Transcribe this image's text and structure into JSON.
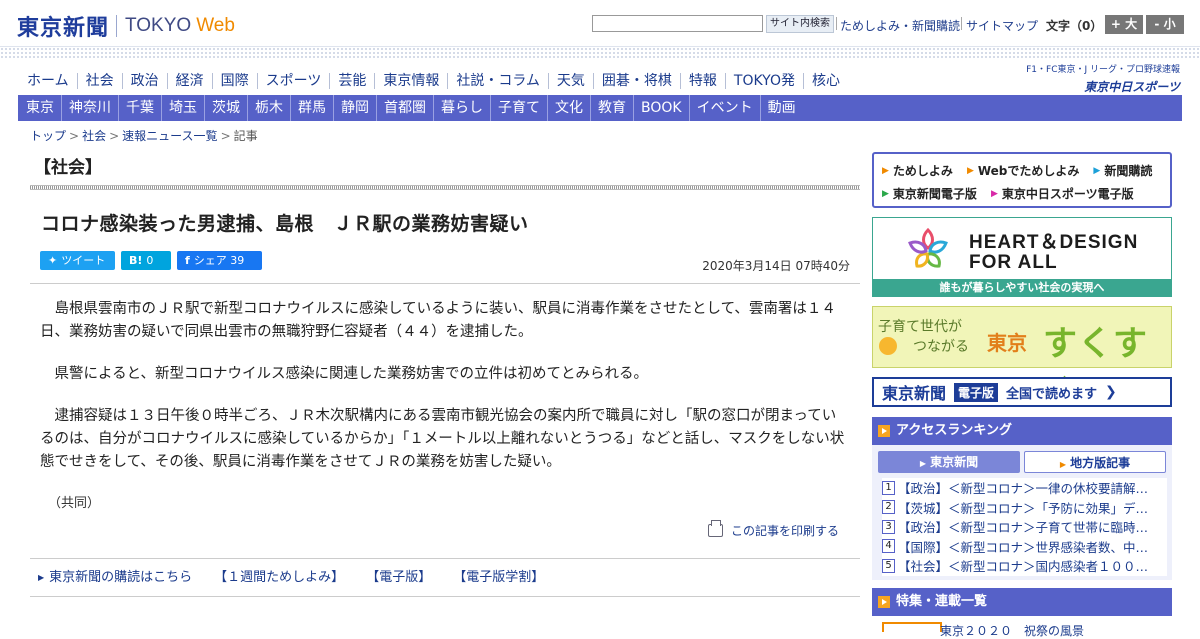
{
  "header": {
    "logo_jp": "東京新聞",
    "logo_en": "TOKYO",
    "logo_web": "Web",
    "search_button": "サイト内検索",
    "links": [
      "ためしよみ・新聞購読",
      "サイトマップ"
    ],
    "font_label": "文字（0）",
    "font_bigger": "+ 大",
    "font_smaller": "- 小"
  },
  "nav_primary": [
    "ホーム",
    "社会",
    "政治",
    "経済",
    "国際",
    "スポーツ",
    "芸能",
    "東京情報",
    "社説・コラム",
    "天気",
    "囲碁・将棋",
    "特報",
    "TOKYO発",
    "核心"
  ],
  "chunichi": {
    "small": "F1・FC東京・J リーグ・プロ野球速報",
    "brand": "東京中日スポーツ"
  },
  "nav_secondary": [
    "東京",
    "神奈川",
    "千葉",
    "埼玉",
    "茨城",
    "栃木",
    "群馬",
    "静岡",
    "首都圏",
    "暮らし",
    "子育て",
    "文化",
    "教育",
    "BOOK",
    "イベント",
    "動画"
  ],
  "breadcrumb": [
    "トップ",
    "社会",
    "速報ニュース一覧",
    "記事"
  ],
  "article": {
    "section": "【社会】",
    "headline": "コロナ感染装った男逮捕、島根　ＪＲ駅の業務妨害疑い",
    "share": {
      "tweet": "ツイート",
      "hatena_count": "0",
      "fb_label": "シェア",
      "fb_count": "39"
    },
    "date": "2020年3月14日 07時40分",
    "paragraphs": [
      "　島根県雲南市のＪＲ駅で新型コロナウイルスに感染しているように装い、駅員に消毒作業をさせたとして、雲南署は１４日、業務妨害の疑いで同県出雲市の無職狩野仁容疑者（４４）を逮捕した。",
      "　県警によると、新型コロナウイルス感染に関連した業務妨害での立件は初めてとみられる。",
      "　逮捕容疑は１３日午後０時半ごろ、ＪＲ木次駅構内にある雲南市観光協会の案内所で職員に対し「駅の窓口が閉まっているのは、自分がコロナウイルスに感染しているからか」「１メートル以上離れないとうつる」などと話し、マスクをしない状態でせきをして、その後、駅員に消毒作業をさせてＪＲの業務を妨害した疑い。"
    ],
    "credit": "（共同）",
    "print_label": "この記事を印刷する"
  },
  "sub_links": [
    "東京新聞の購読はこちら",
    "【１週間ためしよみ】",
    "【電子版】",
    "【電子版学割】"
  ],
  "sidebar": {
    "promo_row1": [
      "ためしよみ",
      "Webでためしよみ",
      "新聞購読"
    ],
    "promo_row2": [
      "東京新聞電子版",
      "東京中日スポーツ電子版"
    ],
    "heart_title1": "HEART＆DESIGN",
    "heart_title2": "FOR ALL",
    "heart_caption": "誰もが暮らしやすい社会の実現へ",
    "suku_small1": "子育て世代が",
    "suku_small2": "つながる",
    "suku_tokyo": "東京",
    "suku_big": "すくすく",
    "denshi_name": "東京新聞",
    "denshi_tag": "電子版",
    "denshi_cta": "全国で読めます",
    "ranking_title": "アクセスランキング",
    "ranking_tabs": [
      "東京新聞",
      "地方版記事"
    ],
    "ranking": [
      {
        "num": "1",
        "text": "【政治】＜新型コロナ＞一律の休校要請解…"
      },
      {
        "num": "2",
        "text": "【茨城】＜新型コロナ＞「予防に効果」デ…"
      },
      {
        "num": "3",
        "text": "【政治】＜新型コロナ＞子育て世帯に臨時…"
      },
      {
        "num": "4",
        "text": "【国際】＜新型コロナ＞世界感染者数、中…"
      },
      {
        "num": "5",
        "text": "【社会】＜新型コロナ＞国内感染者１００…"
      }
    ],
    "feature_title": "特集・連載一覧",
    "feature_peek": "東京２０２０　祝祭の風景"
  },
  "colors": {
    "brand_blue": "#1f3d9c",
    "nav_bg": "#5661c8",
    "accent_orange": "#f08a00",
    "heart_green": "#3aa690"
  }
}
